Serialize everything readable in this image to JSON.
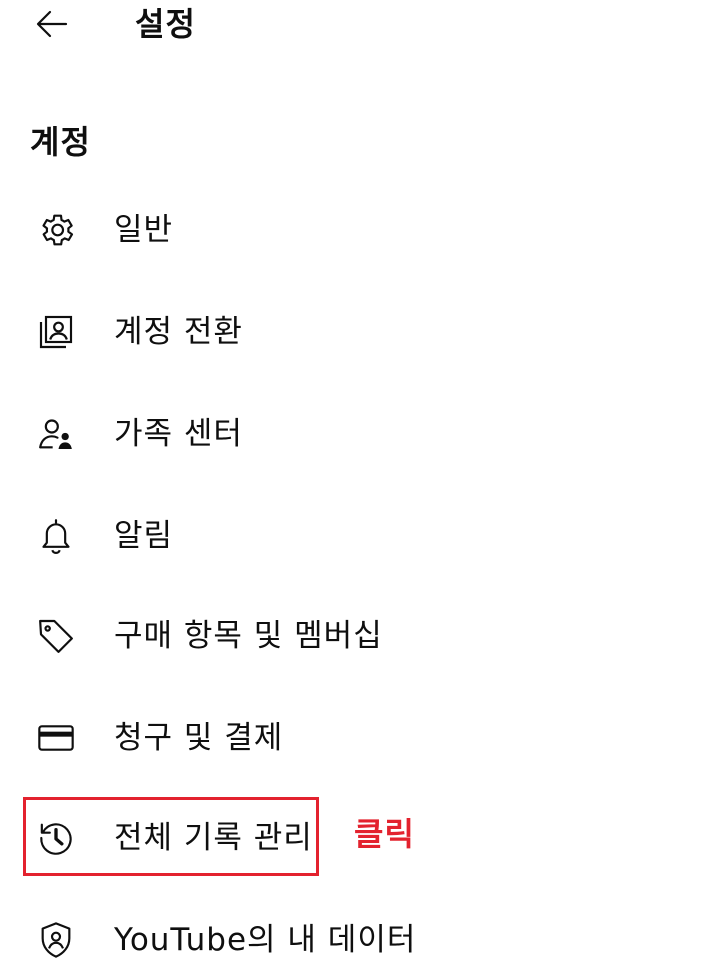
{
  "header": {
    "back_icon": "arrow-left-icon",
    "title": "설정"
  },
  "section": {
    "heading": "계정"
  },
  "menu": {
    "items": [
      {
        "id": "general",
        "icon": "gear-icon",
        "label": "일반"
      },
      {
        "id": "switch-account",
        "icon": "account-box-icon",
        "label": "계정 전환"
      },
      {
        "id": "family-center",
        "icon": "family-icon",
        "label": "가족 센터"
      },
      {
        "id": "notifications",
        "icon": "bell-icon",
        "label": "알림"
      },
      {
        "id": "purchases",
        "icon": "tag-icon",
        "label": "구매 항목 및 멤버십"
      },
      {
        "id": "billing",
        "icon": "credit-card-icon",
        "label": "청구 및 결제"
      },
      {
        "id": "history",
        "icon": "history-icon",
        "label": "전체 기록 관리"
      },
      {
        "id": "your-data",
        "icon": "shield-person-icon",
        "label": "YouTube의 내 데이터"
      }
    ]
  },
  "annotation": {
    "text": "클릭",
    "highlight_color": "#e3222e"
  }
}
